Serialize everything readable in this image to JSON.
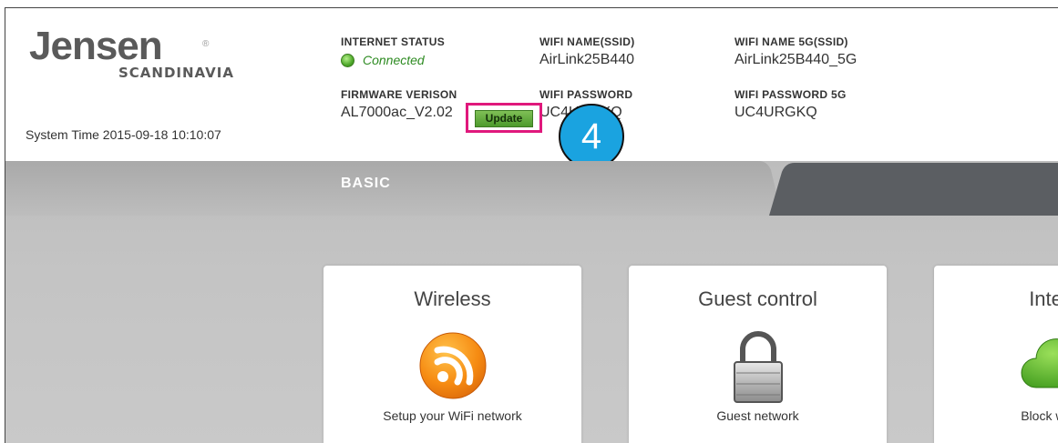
{
  "brand": {
    "name": "Jensen",
    "sub": "SCANDINAVIA",
    "reg": "®"
  },
  "system_time": "System Time 2015-09-18 10:10:07",
  "status": {
    "internet_label": "INTERNET STATUS",
    "internet_value": "Connected",
    "ssid_label": "WIFI NAME(SSID)",
    "ssid_value": "AirLink25B440",
    "ssid5_label": "WIFI NAME 5G(SSID)",
    "ssid5_value": "AirLink25B440_5G",
    "firmware_label": "FIRMWARE VERISON",
    "firmware_value": "AL7000ac_V2.02",
    "password_label": "WIFI PASSWORD",
    "password_value": "UC4URGKQ",
    "password5_label": "WIFI PASSWORD 5G",
    "password5_value": "UC4URGKQ"
  },
  "update_button": "Update",
  "step_number": "4",
  "tabs": {
    "basic": "BASIC"
  },
  "cards": [
    {
      "title": "Wireless",
      "desc": "Setup your WiFi network",
      "icon": "wifi-rss-icon"
    },
    {
      "title": "Guest control",
      "desc": "Guest network",
      "icon": "padlock-icon"
    },
    {
      "title": "Internet",
      "desc": "Block websites",
      "icon": "cloud-icon"
    }
  ],
  "colors": {
    "accent_green": "#4d9a2c",
    "highlight_pink": "#e0187c",
    "step_blue": "#1aa3e0",
    "tab_dark": "#5b5e62",
    "band_grey": "#c4c4c4"
  }
}
